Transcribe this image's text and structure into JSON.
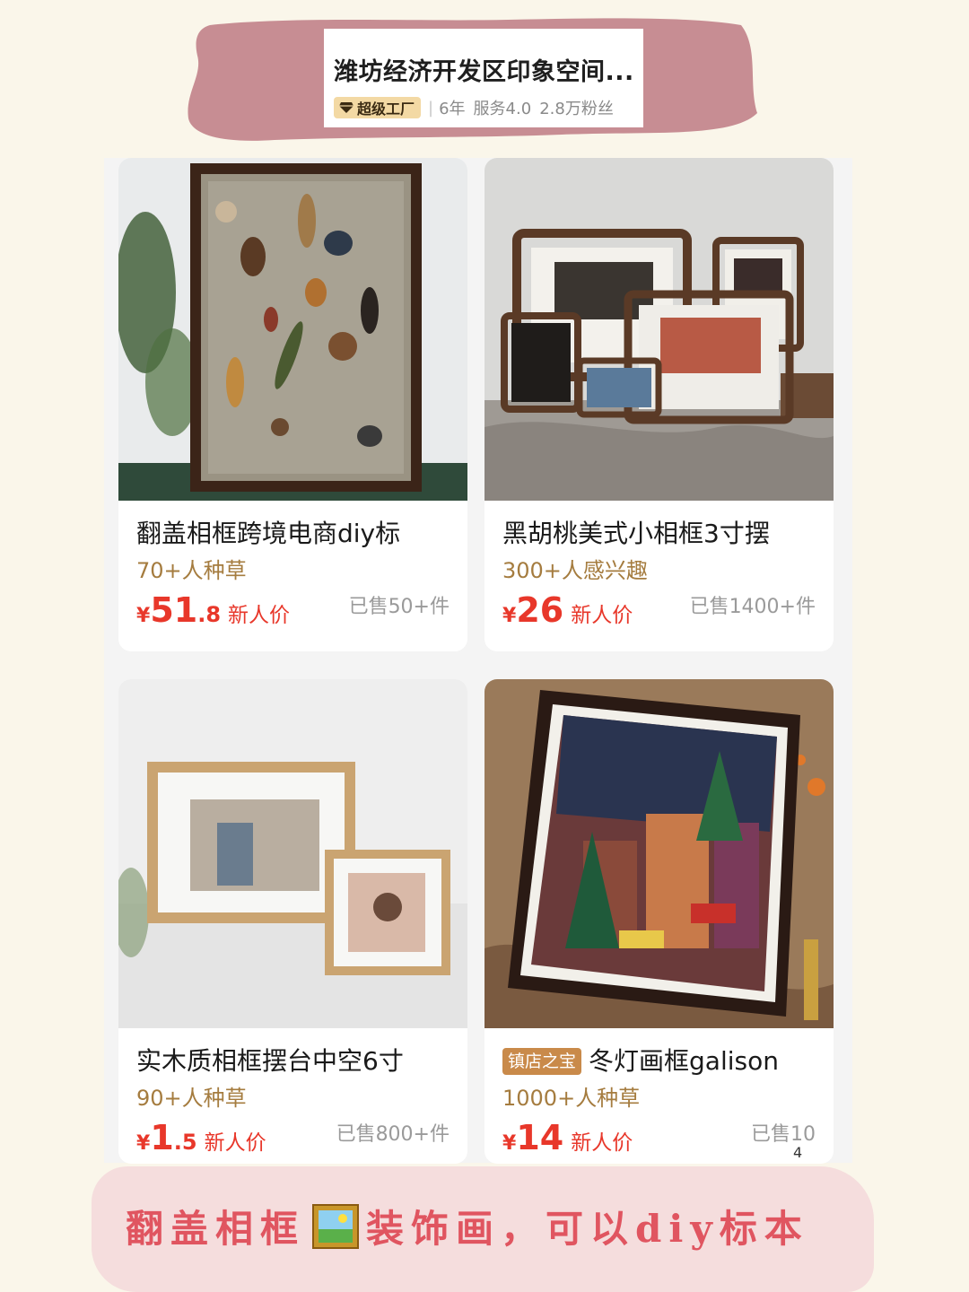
{
  "shop": {
    "name": "潍坊经济开发区印象空间...",
    "badge": "超级工厂",
    "years": "6年",
    "service": "服务4.0",
    "fans": "2.8万粉丝"
  },
  "products": [
    {
      "title": "翻盖相框跨境电商diy标",
      "interest": "70+人种草",
      "price_symbol": "¥",
      "price_int": "51",
      "price_dec": ".8",
      "price_tag": "新人价",
      "sold": "已售50+件"
    },
    {
      "title": "黑胡桃美式小相框3寸摆",
      "interest": "300+人感兴趣",
      "price_symbol": "¥",
      "price_int": "26",
      "price_dec": "",
      "price_tag": "新人价",
      "sold": "已售1400+件"
    },
    {
      "title": "实木质相框摆台中空6寸",
      "interest": "90+人种草",
      "price_symbol": "¥",
      "price_int": "1",
      "price_dec": ".5",
      "price_tag": "新人价",
      "sold": "已售800+件"
    },
    {
      "badge": "镇店之宝",
      "title": "冬灯画框galison",
      "interest": "1000+人种草",
      "price_symbol": "¥",
      "price_int": "14",
      "price_dec": "",
      "price_tag": "新人价",
      "sold": "已售10"
    }
  ],
  "page_number": "4",
  "caption": {
    "before": "翻盖相框",
    "after": "装饰画，可以diy标本"
  },
  "colors": {
    "background": "#faf6ea",
    "banner": "#c78d93",
    "price": "#e8372a",
    "interest": "#a57c3f",
    "caption_text": "#e05560",
    "caption_bg": "#f5dddd"
  }
}
